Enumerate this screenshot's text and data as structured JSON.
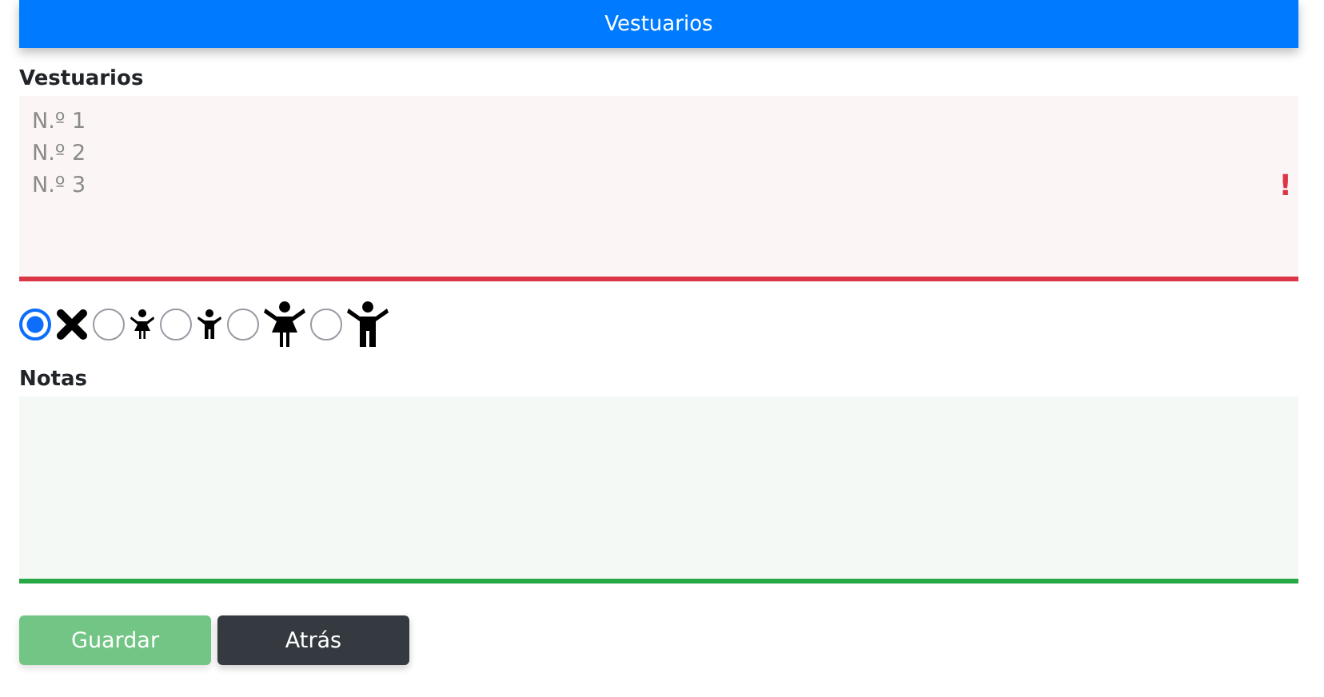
{
  "header": {
    "title": "Vestuarios"
  },
  "vestuarios": {
    "label": "Vestuarios",
    "placeholder": "N.º 1\nN.º 2\nN.º 3",
    "valid": false,
    "error_mark": "!"
  },
  "options": [
    {
      "kind": "none",
      "selected": true
    },
    {
      "kind": "girl",
      "selected": false
    },
    {
      "kind": "boy",
      "selected": false
    },
    {
      "kind": "woman",
      "selected": false
    },
    {
      "kind": "man",
      "selected": false
    }
  ],
  "notas": {
    "label": "Notas",
    "valid": true
  },
  "buttons": [
    {
      "label": "Guardar",
      "kind": "save",
      "disabled": true
    },
    {
      "label": "Atrás",
      "kind": "back",
      "disabled": false
    }
  ]
}
